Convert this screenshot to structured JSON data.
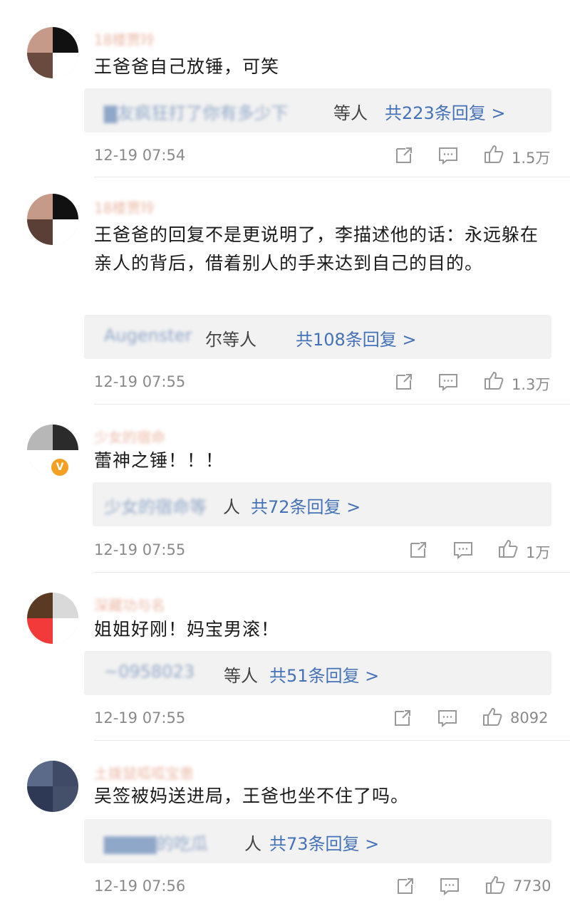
{
  "comments": [
    {
      "username": "18楼贾玲",
      "text": "王爸爸自己放锤，可笑",
      "reply_names": "▇友疯狂打了你有多少下",
      "reply_deng": "等人",
      "reply_link": "共223条回复 >",
      "time": "12-19 07:54",
      "likes": "1.5万",
      "avatar_colors": [
        "#c59a88",
        "#111111",
        "#6a4a3f",
        "#ffffff"
      ]
    },
    {
      "username": "18楼贾玲",
      "text": "王爸爸的回复不是更说明了，李描述他的话：永远躲在亲人的背后，借着别人的手来达到自己的目的。",
      "reply_names": "Augenster",
      "reply_deng": "尔等人",
      "reply_link": "共108条回复 >",
      "time": "12-19 07:55",
      "likes": "1.3万",
      "avatar_colors": [
        "#c59a88",
        "#111111",
        "#5a3f36",
        "#ffffff"
      ]
    },
    {
      "username": "少女的宿命",
      "text": "蕾神之锤！！！",
      "reply_names": "少女的宿命等",
      "reply_deng": "人",
      "reply_link": "共72条回复 >",
      "time": "12-19 07:55",
      "likes": "1万",
      "avatar_colors": [
        "#b7b7b7",
        "#2b2b2b",
        "#ffffff",
        "#ffffff"
      ]
    },
    {
      "username": "深藏功与名",
      "text": "姐姐好刚！妈宝男滚！",
      "reply_names": "~0958023",
      "reply_deng": "等人",
      "reply_link": "共51条回复 >",
      "time": "12-19 07:55",
      "likes": "8092",
      "avatar_colors": [
        "#5a3a22",
        "#d9d9d9",
        "#f23a3a",
        "#ffffff"
      ]
    },
    {
      "username": "土拨鼠呱呱宝患",
      "text": "吴签被妈送进局，王爸也坐不住了吗。",
      "reply_names": "▇▇▇▇的吃瓜",
      "reply_deng": "人",
      "reply_link": "共73条回复 >",
      "time": "12-19 07:56",
      "likes": "7730",
      "avatar_colors": [
        "#5a6a88",
        "#3f4a66",
        "#2e3a55",
        "#444f6a"
      ]
    }
  ],
  "icons": {
    "share": "share-icon",
    "comment": "comment-icon",
    "like": "thumbs-up-icon"
  },
  "colors": {
    "link": "#4472b8",
    "meta": "#8a8a8a",
    "reply_bg": "#f2f2f2",
    "badge": "#f4a024"
  }
}
